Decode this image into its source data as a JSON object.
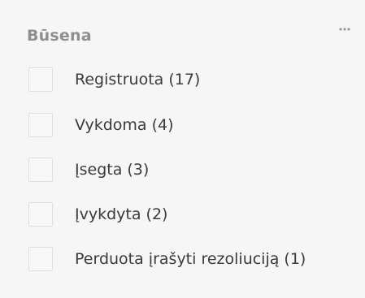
{
  "filter_panel": {
    "title": "Būsena",
    "more_icon": "more-horizontal-icon",
    "options": [
      {
        "label": "Registruota (17)",
        "checked": false
      },
      {
        "label": "Vykdoma (4)",
        "checked": false
      },
      {
        "label": "Įsegta (3)",
        "checked": false
      },
      {
        "label": "Įvykdyta (2)",
        "checked": false
      },
      {
        "label": "Perduota įrašyti rezoliuciją (1)",
        "checked": false
      }
    ]
  },
  "colors": {
    "panel_background": "#f6f6f6",
    "title_text": "#8f8f8f",
    "label_text": "#3a3a3a",
    "checkbox_border": "#dedede"
  }
}
